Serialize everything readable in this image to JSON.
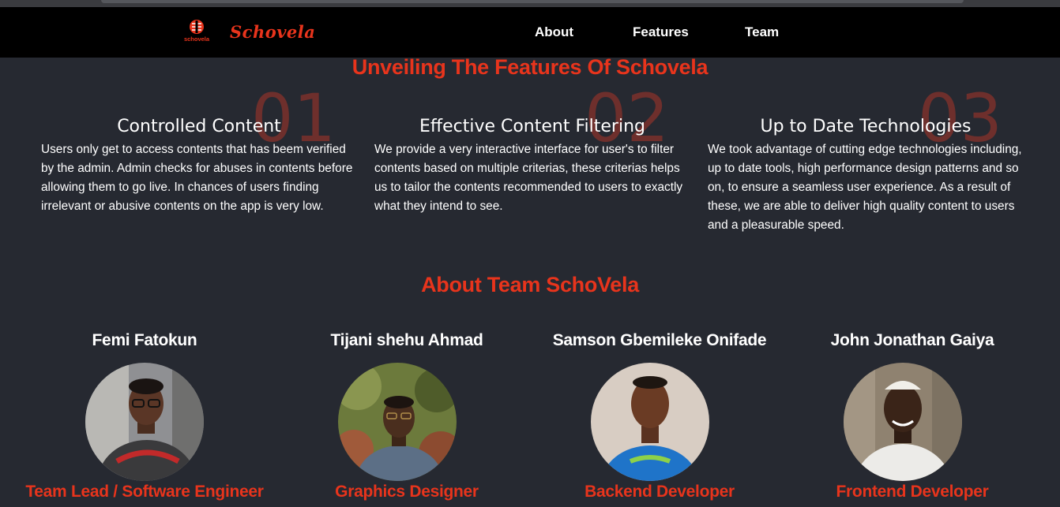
{
  "nav": {
    "brand": "Schovela",
    "logo_text": "schovela",
    "links": [
      "About",
      "Features",
      "Team"
    ]
  },
  "features": {
    "title": "Unveiling The Features Of Schovela",
    "items": [
      {
        "number": "01",
        "title": "Controlled Content",
        "body": "Users only get to access contents that has beem verified by the admin. Admin checks for abuses in contents before allowing them to go live. In chances of users finding irrelevant or abusive contents on the app is very low."
      },
      {
        "number": "02",
        "title": "Effective Content Filtering",
        "body": "We provide a very interactive interface for user's to filter contents based on multiple criterias, these criterias helps us to tailor the contents recommended to users to exactly what they intend to see."
      },
      {
        "number": "03",
        "title": "Up to Date Technologies",
        "body": "We took advantage of cutting edge technologies including, up to date tools, high performance design patterns and so on, to ensure a seamless user experience. As a result of these, we are able to deliver high quality content to users and a pleasurable speed."
      }
    ]
  },
  "team": {
    "title": "About Team SchoVela",
    "members": [
      {
        "name": "Femi Fatokun",
        "role": "Team Lead / Software Engineer"
      },
      {
        "name": "Tijani shehu Ahmad",
        "role": "Graphics Designer"
      },
      {
        "name": "Samson Gbemileke Onifade",
        "role": "Backend Developer"
      },
      {
        "name": "John Jonathan Gaiya",
        "role": "Frontend Developer"
      }
    ]
  },
  "colors": {
    "accent": "#e8341c",
    "background": "#262931",
    "navbar": "#000000",
    "number": "#6e2f2c"
  }
}
